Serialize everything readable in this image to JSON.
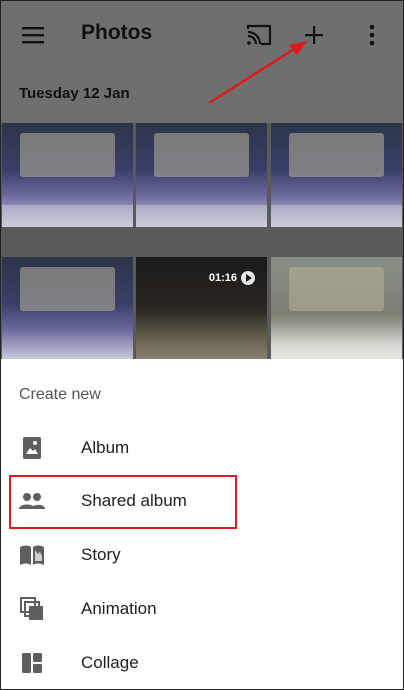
{
  "appbar": {
    "title": "Photos",
    "icons": {
      "menu": "menu-icon",
      "cast": "cast-icon",
      "add": "add-icon",
      "more": "more-vert-icon"
    }
  },
  "date_header": "Tuesday 12 Jan",
  "grid": {
    "video_duration": "01:16"
  },
  "sheet": {
    "header": "Create new",
    "options": [
      {
        "label": "Album",
        "icon": "photo-album-icon"
      },
      {
        "label": "Shared album",
        "icon": "people-icon"
      },
      {
        "label": "Story",
        "icon": "book-icon"
      },
      {
        "label": "Animation",
        "icon": "stack-icon"
      },
      {
        "label": "Collage",
        "icon": "collage-icon"
      }
    ]
  },
  "annotation": {
    "highlight_color": "#e0191f",
    "arrow_color": "#e0191f"
  }
}
